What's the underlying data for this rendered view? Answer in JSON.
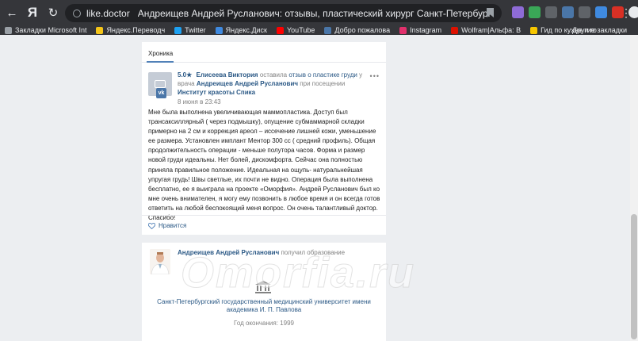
{
  "browser": {
    "back": "←",
    "yandex": "Я",
    "reload": "↻",
    "domain": "like.doctor",
    "tab_title": "Андреищев Андрей Русланович: отзывы, пластический хирург Санкт-Петербург",
    "menu": "⋮"
  },
  "bookmarks": [
    {
      "label": "Закладки Microsoft Int",
      "icon_color": "#9aa0a6"
    },
    {
      "label": "Яндекс.Переводч",
      "icon_color": "#f5c518"
    },
    {
      "label": "Twitter",
      "icon_color": "#1da1f2"
    },
    {
      "label": "Яндекс.Диск",
      "icon_color": "#3f8ae0"
    },
    {
      "label": "YouTube",
      "icon_color": "#ff0000"
    },
    {
      "label": "Добро пожалова",
      "icon_color": "#4a76a8"
    },
    {
      "label": "Instagram",
      "icon_color": "#e1306c"
    },
    {
      "label": "Wolfram|Альфа: В",
      "icon_color": "#dd1100"
    },
    {
      "label": "Гид по кухне и го",
      "icon_color": "#f7c600"
    }
  ],
  "bookmarks_other": "Другие закладки",
  "feed": {
    "tab": "Хроника",
    "post": {
      "rating": "5.0",
      "star": "★",
      "author": "Елисеева Виктория",
      "action": "оставила",
      "review_link": "отзыв о пластике груди",
      "to": "у врача",
      "doctor": "Андреищев Андрей Русланович",
      "at": "при посещении",
      "clinic": "Институт красоты Спика",
      "date": "8 июня в 23:43",
      "more": "•••",
      "vk": "vk",
      "text": "Мне была выполнена увеличивающая маммопластика. Доступ был трансаксиллярный ( через подмышку), опущение субмаммарной складки примерно на 2 см и коррекция ареол – иссечение лишней кожи, уменьшение ее размера. Установлен имплант Ментор 300 сс ( средний профиль). Общая продолжительность операции - меньше полутора часов. Форма и размер новой груди идеальны. Нет болей, дискомфорта. Сейчас она полностью приняла правильное положение. Идеальная на ощупь- натуральнейшая упругая грудь! Швы светлые, их почти не видно. Операция была выполнена бесплатно, ее я выиграла на проекте «Оморфия». Андрей Русланович был ко мне очень внимателен, я могу ему позвонить в любое время и он всегда готов ответить на любой беспокоящий меня вопрос. Он очень талантливый доктор. Спасибо!",
      "like_label": "Нравится"
    },
    "education": {
      "doctor": "Андреищев Андрей Русланович",
      "action": "получил образование",
      "university": "Санкт-Петербургский государственный медицинский университет имени академика И. П. Павлова",
      "year": "Год окончания: 1999"
    }
  },
  "watermark": "Omorfia.ru",
  "colors": {
    "link": "#2a5885",
    "chrome": "#35363a"
  }
}
